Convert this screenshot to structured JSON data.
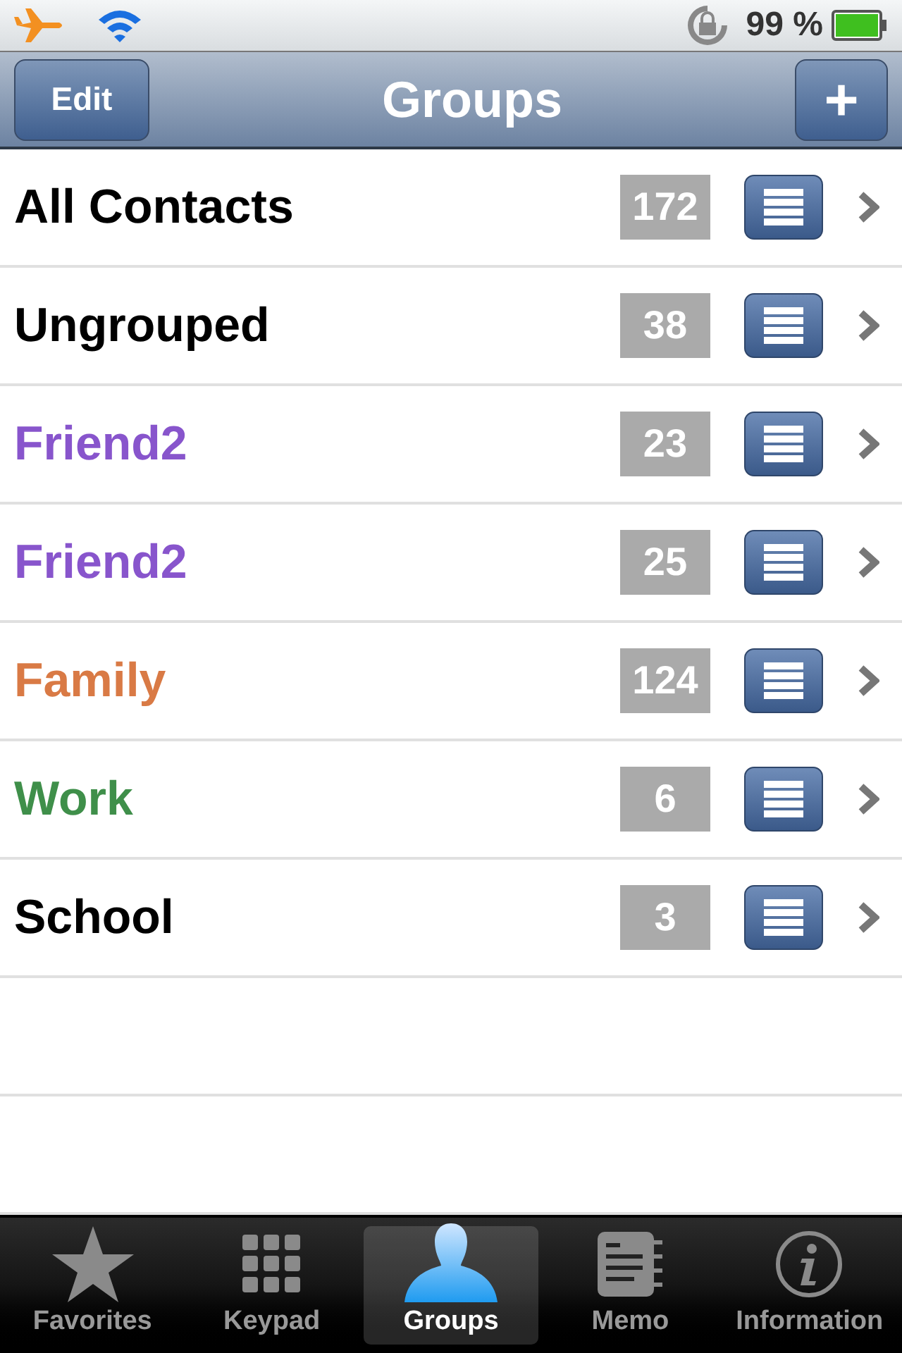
{
  "status_bar": {
    "battery_text": "99 %"
  },
  "nav_bar": {
    "title": "Groups",
    "left_button": "Edit",
    "right_button": "+"
  },
  "groups": [
    {
      "name": "All Contacts",
      "count": "172",
      "color": "#000000"
    },
    {
      "name": "Ungrouped",
      "count": "38",
      "color": "#000000"
    },
    {
      "name": "Friend2",
      "count": "23",
      "color": "#8855cc"
    },
    {
      "name": "Friend2",
      "count": "25",
      "color": "#8855cc"
    },
    {
      "name": "Family",
      "count": "124",
      "color": "#d97a45"
    },
    {
      "name": "Work",
      "count": "6",
      "color": "#3f8f4a"
    },
    {
      "name": "School",
      "count": "3",
      "color": "#000000"
    }
  ],
  "tab_bar": [
    {
      "label": "Favorites",
      "kind": "star",
      "selected": false
    },
    {
      "label": "Keypad",
      "kind": "keypad",
      "selected": false
    },
    {
      "label": "Groups",
      "kind": "person",
      "selected": true
    },
    {
      "label": "Memo",
      "kind": "memo",
      "selected": false
    },
    {
      "label": "Information",
      "kind": "info",
      "selected": false
    }
  ]
}
